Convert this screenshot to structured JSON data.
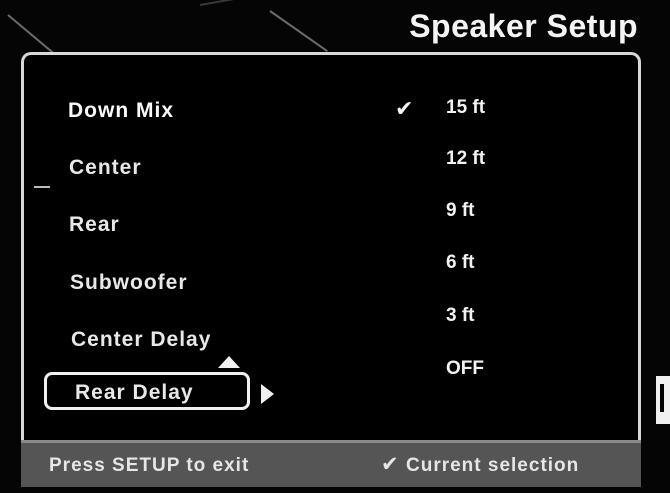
{
  "header": {
    "title": "Speaker Setup"
  },
  "menu": {
    "items": [
      {
        "label": "Down Mix"
      },
      {
        "label": "Center"
      },
      {
        "label": "Rear"
      },
      {
        "label": "Subwoofer"
      },
      {
        "label": "Center Delay"
      },
      {
        "label": "Rear Delay"
      }
    ],
    "highlighted": "Rear Delay"
  },
  "values": {
    "options": [
      {
        "label": "15 ft"
      },
      {
        "label": "12 ft"
      },
      {
        "label": "9 ft"
      },
      {
        "label": "6 ft"
      },
      {
        "label": "3 ft"
      },
      {
        "label": "OFF"
      }
    ],
    "current": "15 ft",
    "check_mark": "✔"
  },
  "footer": {
    "hint_left": "Press SETUP to exit",
    "check_mark": "✔",
    "hint_right": "Current selection"
  },
  "colors": {
    "background": "#000000",
    "text": "#f2f2f2",
    "footer_bar": "#555555",
    "panel_border": "#d8d8d8"
  }
}
